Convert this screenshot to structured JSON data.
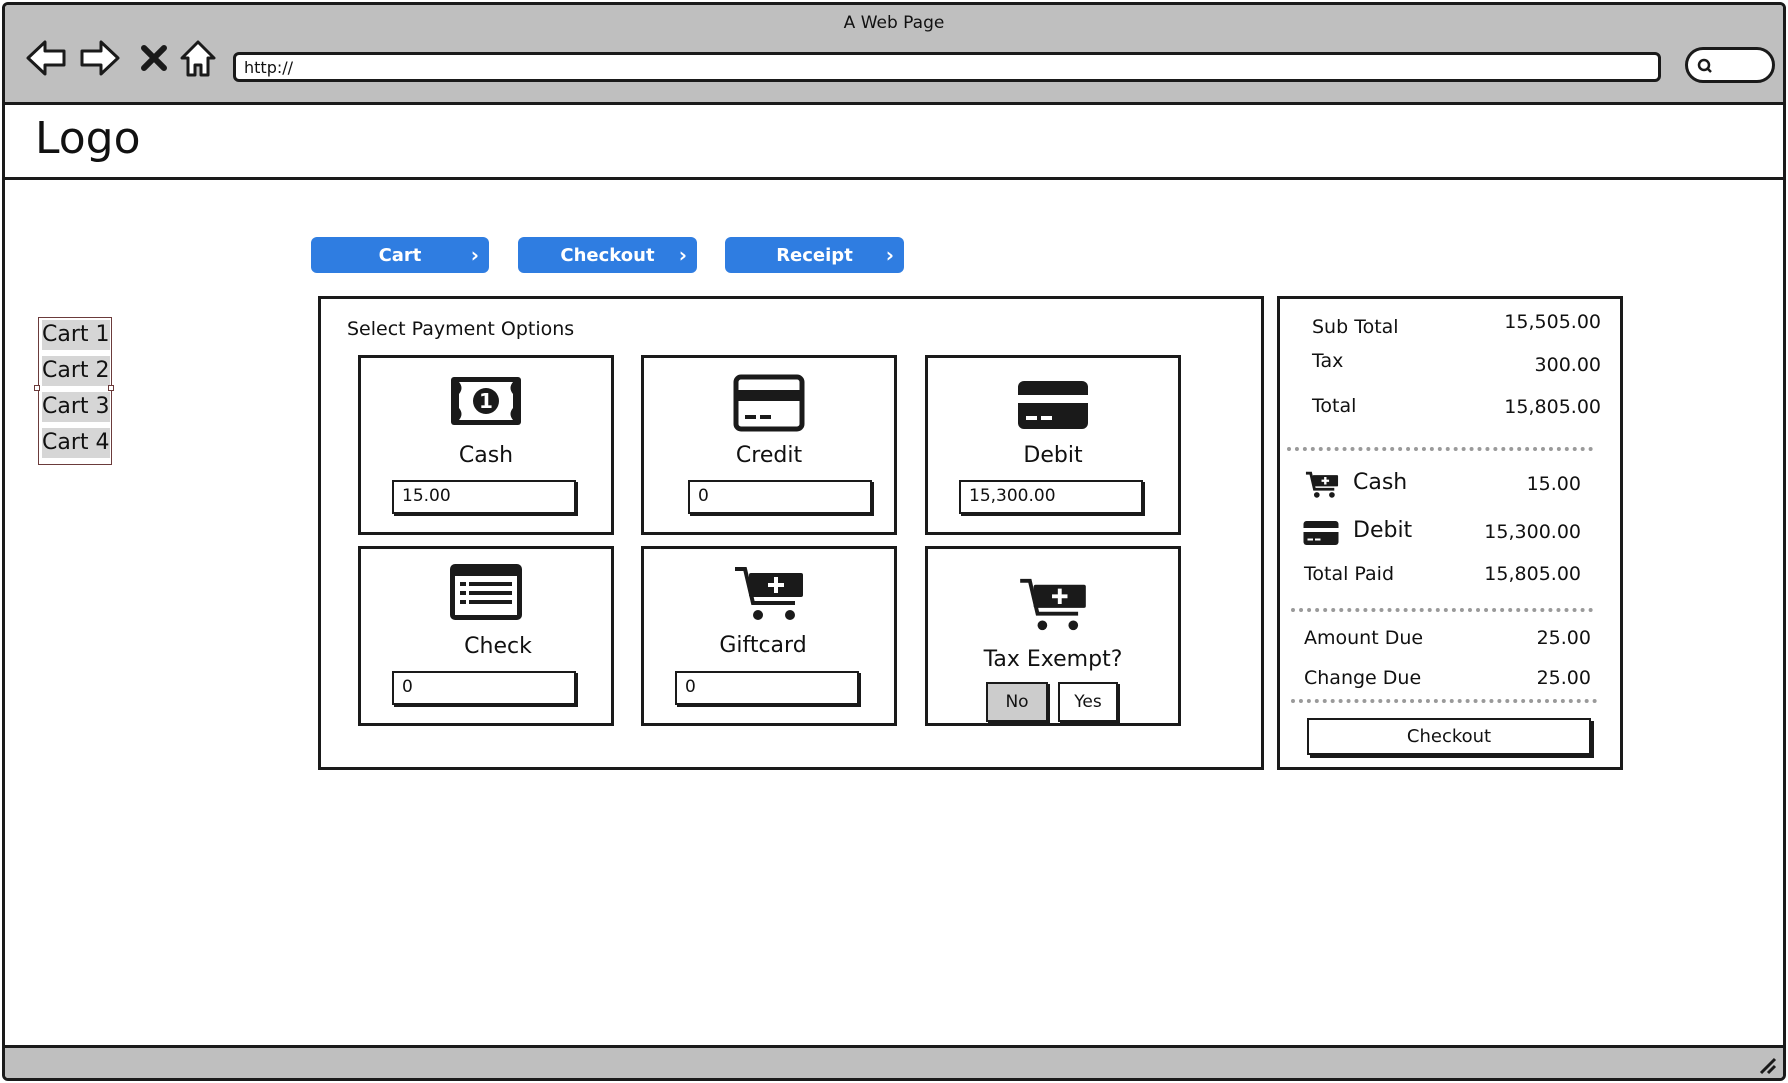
{
  "window": {
    "title": "A Web Page",
    "url": "http://"
  },
  "header": {
    "logo": "Logo"
  },
  "sidebar": {
    "carts": [
      "Cart 1",
      "Cart 2",
      "Cart 3",
      "Cart 4"
    ]
  },
  "steps": [
    "Cart",
    "Checkout",
    "Receipt"
  ],
  "payment": {
    "title": "Select Payment Options",
    "options": [
      {
        "label": "Cash",
        "icon": "cash-icon",
        "value": "15.00"
      },
      {
        "label": "Credit",
        "icon": "credit-card-icon",
        "value": "0"
      },
      {
        "label": "Debit",
        "icon": "debit-card-icon",
        "value": "15,300.00"
      },
      {
        "label": "Check",
        "icon": "check-icon",
        "value": "0"
      },
      {
        "label": "Giftcard",
        "icon": "cart-plus-icon",
        "value": "0"
      }
    ],
    "tax_exempt": {
      "label": "Tax Exempt?",
      "no": "No",
      "yes": "Yes",
      "selected": "No"
    }
  },
  "summary": {
    "sub_total_label": "Sub Total",
    "sub_total": "15,505.00",
    "tax_label": "Tax",
    "tax": "300.00",
    "total_label": "Total",
    "total": "15,805.00",
    "paid": [
      {
        "label": "Cash",
        "icon": "cart-plus-icon",
        "value": "15.00"
      },
      {
        "label": "Debit",
        "icon": "debit-card-icon",
        "value": "15,300.00"
      }
    ],
    "total_paid_label": "Total Paid",
    "total_paid": "15,805.00",
    "amount_due_label": "Amount Due",
    "amount_due": "25.00",
    "change_due_label": "Change Due",
    "change_due": "25.00",
    "checkout_label": "Checkout"
  },
  "colors": {
    "accent": "#2f7de1",
    "chrome": "#bfbfbf",
    "selected": "#cccccc"
  }
}
